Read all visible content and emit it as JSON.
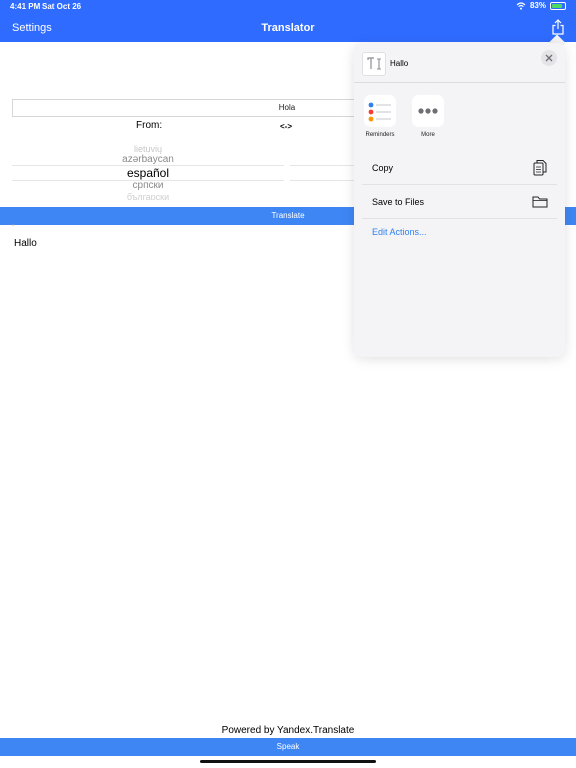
{
  "status_bar": {
    "time": "4:41 PM",
    "date": "Sat Oct 26",
    "battery_text": "83%",
    "battery_level": 0.83
  },
  "nav": {
    "left_label": "Settings",
    "title": "Translator",
    "share_icon": "share-icon"
  },
  "main": {
    "input_value": "Hola",
    "from_label": "From:",
    "swap_label": "<->",
    "language_picker": [
      "lietuvių",
      "azərbaycan",
      "español",
      "српски",
      "български"
    ],
    "translate_label": "Translate",
    "quote_mark": "\"",
    "output_text": "Hallo",
    "powered_by": "Powered by Yandex.Translate",
    "speak_label": "Speak"
  },
  "share_sheet": {
    "preview_title": "Hallo",
    "apps": [
      {
        "label": "Reminders",
        "icon": "reminders-icon"
      },
      {
        "label": "More",
        "icon": "more-icon"
      }
    ],
    "actions": [
      {
        "label": "Copy",
        "icon": "copy-icon"
      },
      {
        "label": "Save to Files",
        "icon": "folder-icon"
      }
    ],
    "edit_actions_label": "Edit Actions..."
  },
  "colors": {
    "nav_blue": "#2f6bff",
    "button_blue": "#3f86f5",
    "link_blue": "#2f7ff0",
    "battery_green": "#4cd964"
  }
}
